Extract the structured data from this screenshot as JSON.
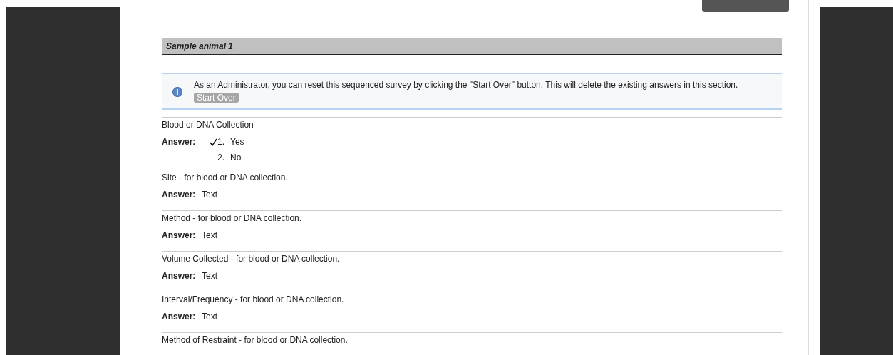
{
  "section": {
    "title": "Sample animal 1"
  },
  "notice": {
    "text": "As an Administrator, you can reset this sequenced survey by clicking the \"Start Over\" button. This will delete the existing answers in this section.",
    "button": "Start Over"
  },
  "questions": [
    {
      "text": "Blood or DNA Collection",
      "answer": {
        "kind": "choice",
        "label": "Answer:",
        "options": [
          {
            "number": "1.",
            "label": "Yes",
            "checked": true
          },
          {
            "number": "2.",
            "label": "No",
            "checked": false
          }
        ]
      }
    },
    {
      "text": "Site - for blood or DNA collection.",
      "answer": {
        "kind": "text",
        "label": "Answer:",
        "value": "Text"
      }
    },
    {
      "text": "Method - for blood or DNA collection.",
      "answer": {
        "kind": "text",
        "label": "Answer:",
        "value": "Text"
      }
    },
    {
      "text": "Volume Collected - for blood or DNA collection.",
      "answer": {
        "kind": "text",
        "label": "Answer:",
        "value": "Text"
      }
    },
    {
      "text": "Interval/Frequency - for blood or DNA collection.",
      "answer": {
        "kind": "text",
        "label": "Answer:",
        "value": "Text"
      }
    },
    {
      "text": "Method of Restraint - for blood or DNA collection."
    }
  ]
}
